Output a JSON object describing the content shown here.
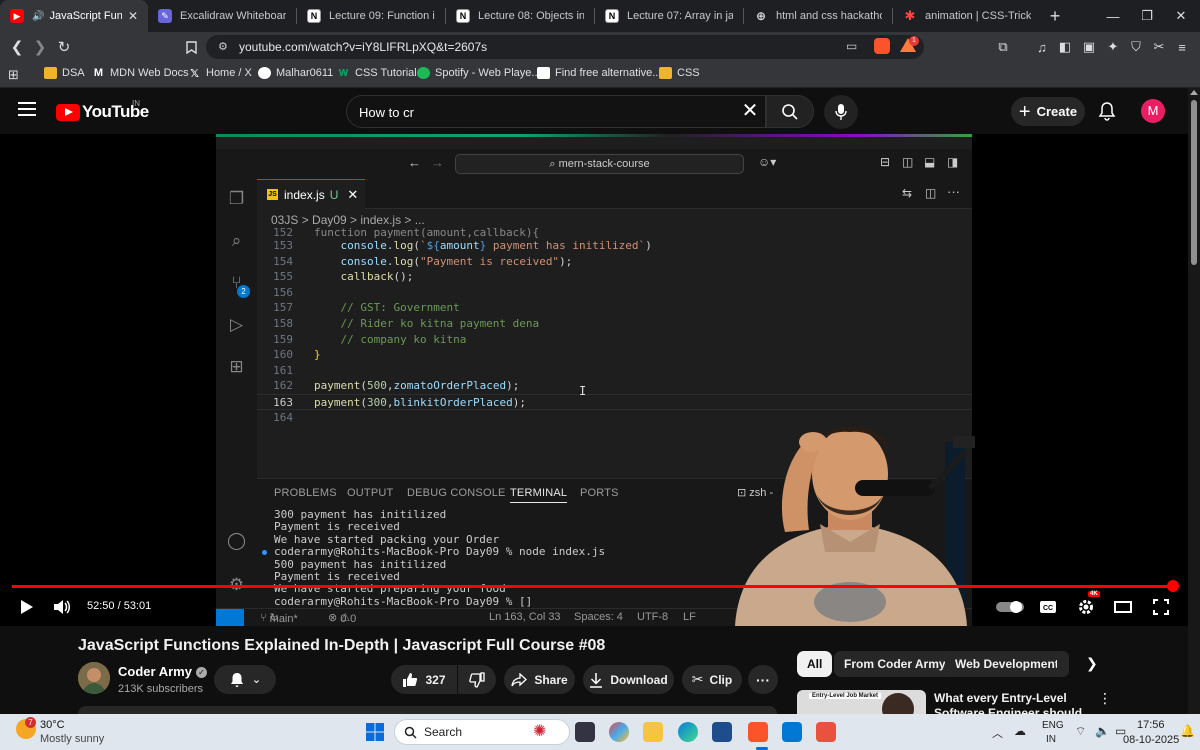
{
  "browser": {
    "tabs": [
      {
        "title": "JavaScript Functions",
        "active": true
      },
      {
        "title": "Excalidraw Whiteboard"
      },
      {
        "title": "Lecture 09: Function in Java"
      },
      {
        "title": "Lecture 08: Objects in Java"
      },
      {
        "title": "Lecture 07: Array in javascript"
      },
      {
        "title": "html and css hackathon - C"
      },
      {
        "title": "animation | CSS-Tricks"
      }
    ],
    "url": "youtube.com/watch?v=iY8LIFRLpXQ&t=2607s",
    "shield_badge": "1",
    "bookmarks": [
      "DSA",
      "MDN Web Docs",
      "Home / X",
      "Malhar0611",
      "CSS Tutorial",
      "Spotify - Web Playe...",
      "Find free alternative...",
      "CSS"
    ]
  },
  "youtube": {
    "wordmark": "YouTube",
    "country": "IN",
    "search_value": "How to cr",
    "create_label": "Create",
    "avatar_letter": "M"
  },
  "video": {
    "vscode": {
      "command_center": "mern-stack-course",
      "tab_label": "index.js",
      "tab_status": "U",
      "breadcrumb": "03JS  >  Day09  >  index.js  >  ...",
      "scm_badge": "2",
      "code_lines": [
        {
          "n": "153",
          "text": "    console.log(`${amount} payment has initilized`)"
        },
        {
          "n": "154",
          "text": "    console.log(\"Payment is received\");"
        },
        {
          "n": "155",
          "text": "    callback();"
        },
        {
          "n": "156",
          "text": ""
        },
        {
          "n": "157",
          "text": "    // GST: Government"
        },
        {
          "n": "158",
          "text": "    // Rider ko kitna payment dena"
        },
        {
          "n": "159",
          "text": "    // company ko kitna"
        },
        {
          "n": "160",
          "text": "}"
        },
        {
          "n": "161",
          "text": ""
        },
        {
          "n": "162",
          "text": "payment(500,zomatoOrderPlaced);"
        },
        {
          "n": "163",
          "text": "payment(300,blinkitOrderPlaced);"
        },
        {
          "n": "164",
          "text": ""
        }
      ],
      "panel_tabs": [
        "PROBLEMS",
        "OUTPUT",
        "DEBUG CONSOLE",
        "TERMINAL",
        "PORTS"
      ],
      "active_panel": "TERMINAL",
      "shell": "zsh -",
      "terminal_lines": [
        "300 payment has initilized",
        "Payment is received",
        "We have started packing your Order",
        "coderarmy@Rohits-MacBook-Pro Day09 % node index.js",
        "500 payment has initilized",
        "Payment is received",
        "We have started preparing your food",
        "coderarmy@Rohits-MacBook-Pro Day09 % []"
      ],
      "status": {
        "branch": "main*",
        "errors": "0",
        "warnings": "0",
        "position": "Ln 163, Col 33",
        "spaces": "Spaces: 4",
        "encoding": "UTF-8",
        "eol": "LF"
      }
    },
    "time": "52:50 / 53:01",
    "progress_fraction": 0.997,
    "quality_badge": "4K",
    "title": "JavaScript Functions Explained In-Depth | Javascript Full Course #08"
  },
  "channel": {
    "name": "Coder Army",
    "subscribers": "213K subscribers"
  },
  "actions": {
    "likes": "327",
    "share": "Share",
    "download": "Download",
    "clip": "Clip"
  },
  "chips": [
    "All",
    "From Coder Army",
    "Web Development"
  ],
  "recommendation": {
    "thumb_label": "Entry-Level Job Market",
    "title": "What every Entry-Level Software Engineer should kno"
  },
  "taskbar": {
    "weather_badge": "7",
    "temp": "30°C",
    "weather": "Mostly sunny",
    "search_label": "Search",
    "lang_top": "ENG",
    "lang_bottom": "IN",
    "time": "17:56",
    "date": "08-10-2025"
  },
  "colors": {
    "yt_red": "#ff0000",
    "vscode_accent": "#0078d4",
    "avatar": "#e91e63"
  }
}
